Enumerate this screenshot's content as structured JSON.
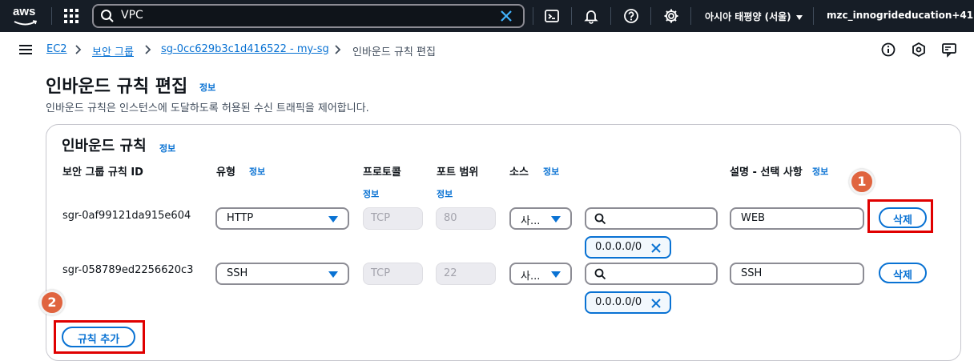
{
  "topnav": {
    "logo_text": "aws",
    "search": {
      "value": "VPC"
    },
    "region": "아시아 태평양 (서울)",
    "account": "mzc_innogrideducation+41"
  },
  "breadcrumb": {
    "items": [
      "EC2",
      "보안 그룹",
      "sg-0cc629b3c1d416522 - my-sg",
      "인바운드 규칙 편집"
    ]
  },
  "page": {
    "title": "인바운드 규칙 편집",
    "info": "정보",
    "description": "인바운드 규칙은 인스턴스에 도달하도록 허용된 수신 트래픽을 제어합니다."
  },
  "panel": {
    "title": "인바운드 규칙",
    "info": "정보",
    "columns": {
      "rule_id": "보안 그룹 규칙 ID",
      "type": "유형",
      "type_info": "정보",
      "protocol": "프로토콜",
      "protocol_info": "정보",
      "port": "포트 범위",
      "port_info": "정보",
      "source": "소스",
      "source_info": "정보",
      "description": "설명 - 선택 사항",
      "description_info": "정보"
    },
    "rules": [
      {
        "id": "sgr-0af99121da915e604",
        "type": "HTTP",
        "protocol": "TCP",
        "port": "80",
        "source": "사...",
        "cidr": "0.0.0.0/0",
        "description": "WEB",
        "delete": "삭제"
      },
      {
        "id": "sgr-058789ed2256620c3",
        "type": "SSH",
        "protocol": "TCP",
        "port": "22",
        "source": "사...",
        "cidr": "0.0.0.0/0",
        "description": "SSH",
        "delete": "삭제"
      }
    ],
    "add_rule": "규칙 추가"
  },
  "annotations": {
    "badge1": "1",
    "badge2": "2",
    "color": "#e0643f",
    "box_color": "#e00000"
  }
}
